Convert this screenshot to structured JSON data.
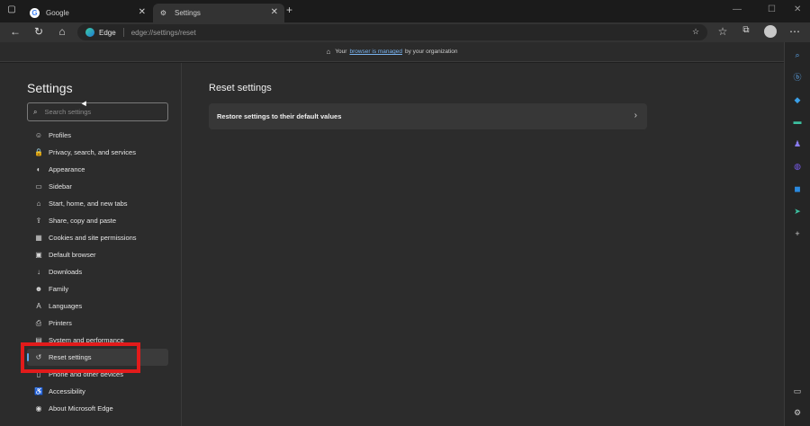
{
  "tabs": [
    {
      "label": "Google",
      "close": "✕"
    },
    {
      "label": "Settings",
      "close": "✕"
    }
  ],
  "new_tab": "+",
  "window_controls": [
    "—",
    "☐",
    "✕"
  ],
  "address_bar": {
    "identity": "Edge",
    "url": "edge://settings/reset"
  },
  "infobar": {
    "prefix": "Your",
    "link": "browser is managed",
    "suffix": "by your organization"
  },
  "sidebar": {
    "title": "Settings",
    "search_placeholder": "Search settings",
    "items": [
      {
        "label": "Profiles",
        "icon": "profiles-icon"
      },
      {
        "label": "Privacy, search, and services",
        "icon": "privacy-icon"
      },
      {
        "label": "Appearance",
        "icon": "appearance-icon"
      },
      {
        "label": "Sidebar",
        "icon": "sidebar-icon"
      },
      {
        "label": "Start, home, and new tabs",
        "icon": "home-icon"
      },
      {
        "label": "Share, copy and paste",
        "icon": "share-icon"
      },
      {
        "label": "Cookies and site permissions",
        "icon": "cookies-icon"
      },
      {
        "label": "Default browser",
        "icon": "default-browser-icon"
      },
      {
        "label": "Downloads",
        "icon": "download-icon"
      },
      {
        "label": "Family",
        "icon": "family-icon"
      },
      {
        "label": "Languages",
        "icon": "languages-icon"
      },
      {
        "label": "Printers",
        "icon": "printer-icon"
      },
      {
        "label": "System and performance",
        "icon": "system-icon"
      },
      {
        "label": "Reset settings",
        "icon": "reset-icon",
        "selected": true
      },
      {
        "label": "Phone and other devices",
        "icon": "phone-icon"
      },
      {
        "label": "Accessibility",
        "icon": "accessibility-icon"
      },
      {
        "label": "About Microsoft Edge",
        "icon": "edge-icon"
      }
    ]
  },
  "main": {
    "title": "Reset settings",
    "card_label": "Restore settings to their default values"
  },
  "colors": {
    "accent": "#5ea9f0",
    "highlight": "#e21b1b"
  }
}
